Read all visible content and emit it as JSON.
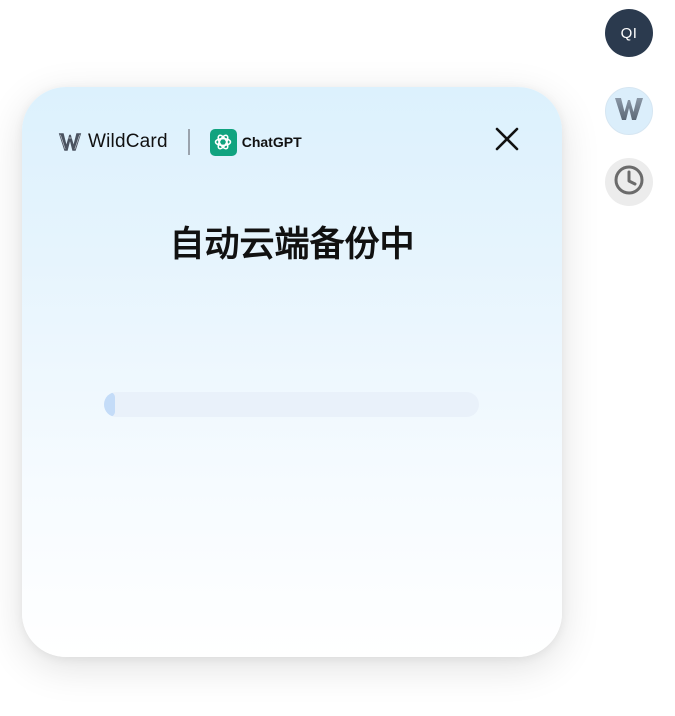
{
  "sidebar": {
    "avatar_initials": "QI",
    "wildcard_icon": "wildcard-w-icon",
    "history_icon": "clock-icon"
  },
  "modal": {
    "brand_name": "WildCard",
    "partner_name": "ChatGPT",
    "title": "自动云端备份中",
    "progress_fraction": 0.03,
    "close_icon": "close-icon"
  },
  "colors": {
    "avatar_bg": "#2b3a4e",
    "chatgpt_green": "#10a37f",
    "progress_track": "#e9f1fa",
    "progress_fill": "#c4dcf8"
  }
}
